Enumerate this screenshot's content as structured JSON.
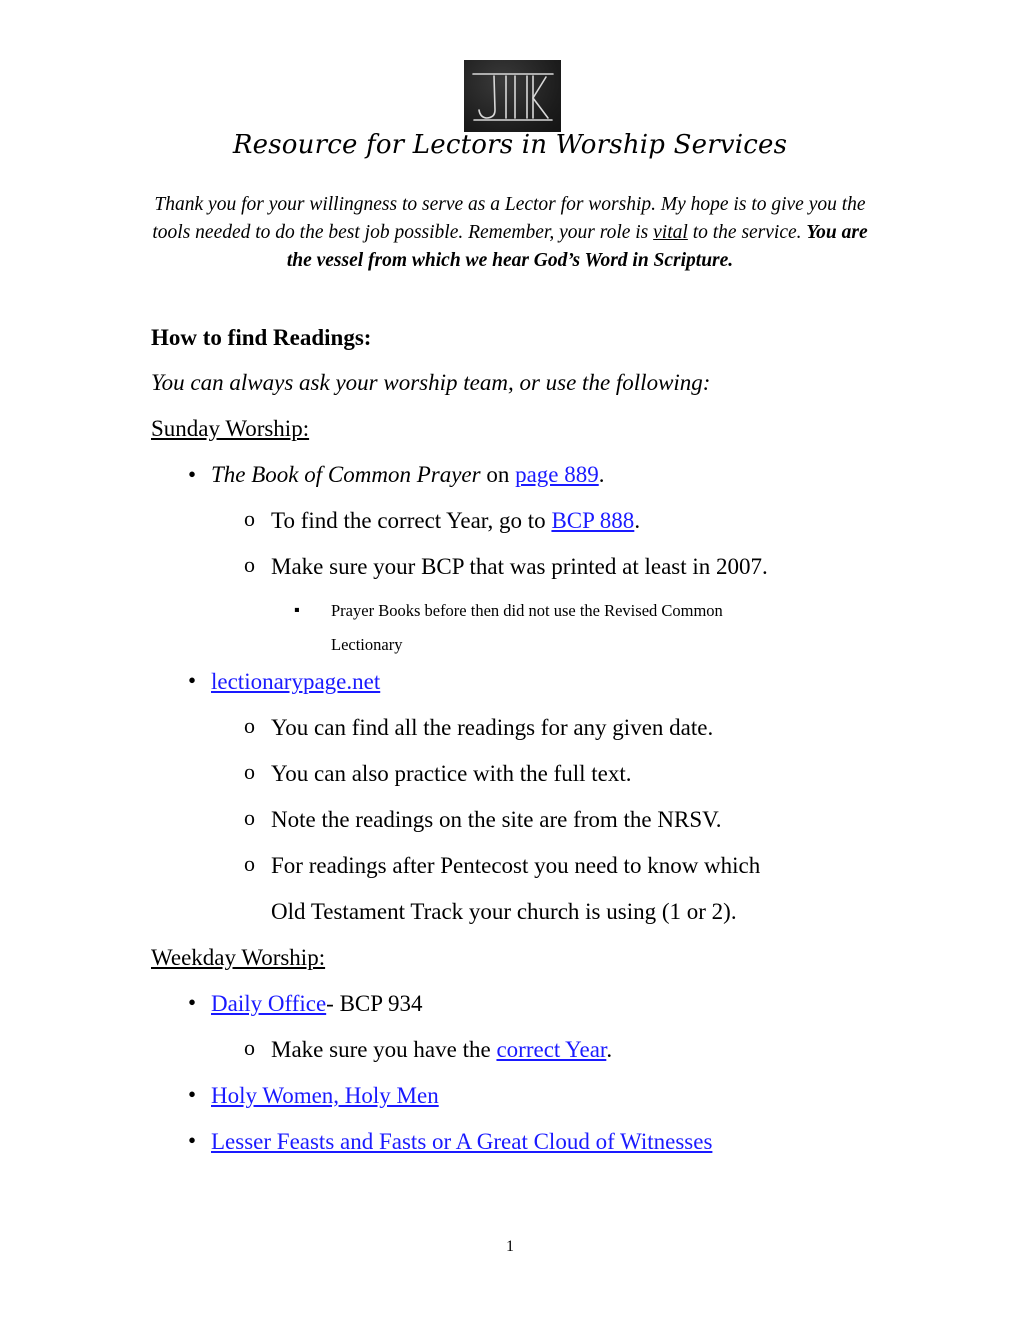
{
  "logo": {
    "text": "JIK",
    "icon": "chalkboard-monogram"
  },
  "title": "Resource for Lectors in Worship Services",
  "intro": {
    "part1": "Thank you for your willingness to serve as a Lector for worship. My hope is to give you the tools needed to do the best job possible. Remember, your role is ",
    "underlined": "vital",
    "part2": " to the service. ",
    "bold": "You are the vessel from which we hear God’s Word in Scripture."
  },
  "heading": "How to find Readings:",
  "subheading": "You can always ask your worship team, or use the following:",
  "sunday": {
    "label": "Sunday Worship:",
    "bcp": {
      "italic": "The Book of Common Prayer",
      "text": " on ",
      "link": "page 889",
      "end": ".",
      "sub1": {
        "text": "To find the correct Year, go to ",
        "link": "BCP 888",
        "end": "."
      },
      "sub2": {
        "text": "Make sure your BCP that was printed at least in 2007."
      },
      "note_line1": "Prayer Books before then did not use the Revised Common",
      "note_line2": "Lectionary"
    },
    "lectionary": {
      "link": "lectionarypage.net",
      "items": [
        "You can find all the readings for any given date.",
        "You can also practice with the full text.",
        "Note the readings on the site are from the NRSV.",
        "For readings after Pentecost you need to know which"
      ],
      "continuation": "Old Testament Track your church is using (1 or 2)."
    }
  },
  "weekday": {
    "label": "Weekday Worship:",
    "daily_office": {
      "link": "Daily Office",
      "text": "- BCP 934"
    },
    "daily_sub": {
      "text": "Make sure you have the ",
      "link": "correct Year",
      "end": "."
    },
    "holy": {
      "link": "Holy Women, Holy Men"
    },
    "lesser": {
      "link": "Lesser Feasts and Fasts or A Great Cloud of Witnesses"
    }
  },
  "bullets": {
    "disc": "•",
    "circle": "o",
    "square": "▪"
  },
  "colors": {
    "link": "#1a1aff",
    "text": "#000000"
  },
  "page_number": "1"
}
